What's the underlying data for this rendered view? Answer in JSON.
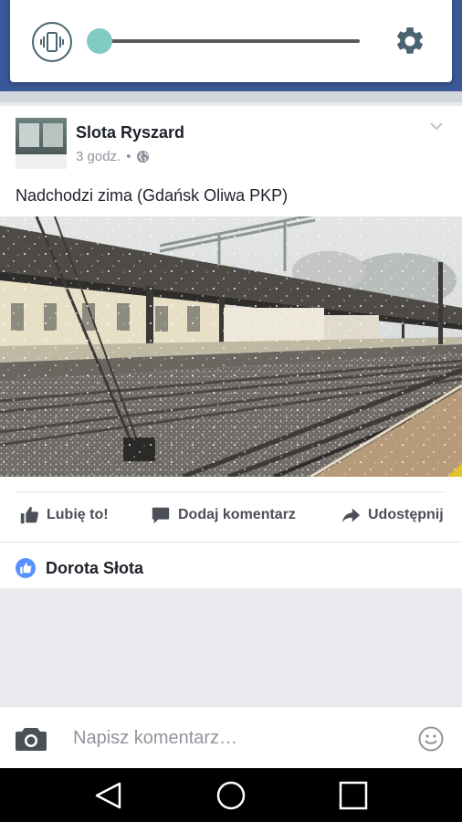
{
  "volume_panel": {
    "mode_icon": "vibrate-icon",
    "settings_icon": "gear-icon",
    "level": 0.0,
    "accent_color": "#80cbc4"
  },
  "post": {
    "author": "Slota Ryszard",
    "time": "3 godz.",
    "separator": "•",
    "privacy_icon": "globe-icon",
    "text": "Nadchodzi zima (Gdańsk Oliwa PKP)",
    "actions": {
      "like": "Lubię to!",
      "comment": "Dodaj komentarz",
      "share": "Udostępnij"
    },
    "liked_by": "Dorota Słota"
  },
  "comment_bar": {
    "placeholder": "Napisz komentarz…",
    "camera_icon": "camera-icon",
    "emoji_icon": "smiley-icon"
  },
  "navigation": {
    "back_icon": "back-triangle-icon",
    "home_icon": "home-circle-icon",
    "recents_icon": "recents-square-icon"
  },
  "colors": {
    "brand_blue": "#3b5998",
    "like_blue": "#5890ff"
  }
}
